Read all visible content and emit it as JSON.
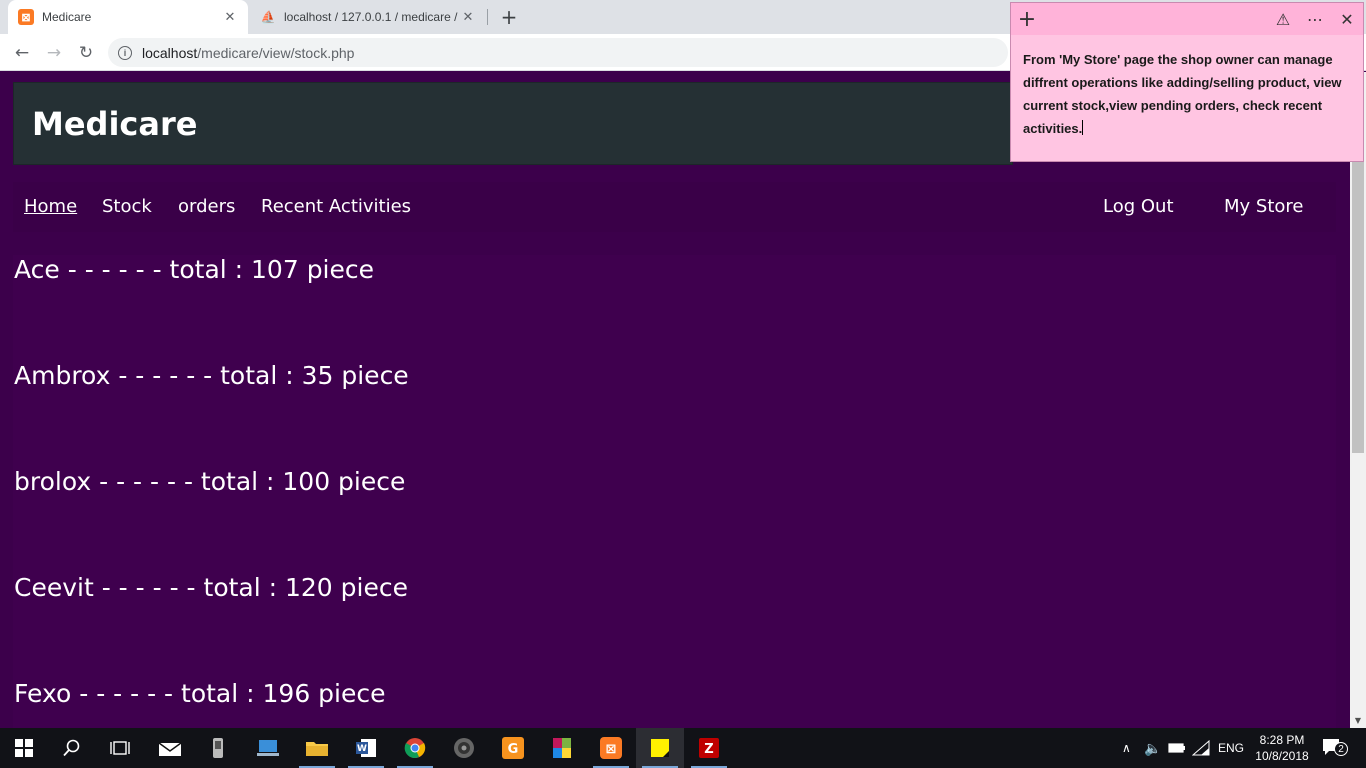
{
  "browser": {
    "tabs": [
      {
        "title": "Medicare",
        "icon": "xampp-icon"
      },
      {
        "title": "localhost / 127.0.0.1 / medicare /",
        "icon": "phpmyadmin-icon"
      }
    ],
    "new_tab_label": "+",
    "address": {
      "host": "localhost",
      "path": "/medicare/view/stock.php"
    }
  },
  "site": {
    "title": "Medicare",
    "nav_left": [
      "Home",
      "Stock",
      "orders",
      "Recent Activities"
    ],
    "nav_right": [
      "Log Out",
      "My Store"
    ],
    "stock": [
      "Ace - - - - - - total : 107 piece",
      "Ambrox - - - - - - total : 35 piece",
      "brolox - - - - - - total : 100 piece",
      "Ceevit - - - - - - total : 120 piece",
      "Fexo - - - - - - total : 196 piece"
    ]
  },
  "sticky_note": {
    "text": "From 'My Store' page the shop owner can manage diffrent operations like adding/selling product, view current stock,view pending orders, check recent activities."
  },
  "taskbar": {
    "language": "ENG",
    "time": "8:28 PM",
    "date": "10/8/2018",
    "notifications": "2"
  },
  "colors": {
    "page_bg": "#3c004b",
    "header_bg": "#253034",
    "sticky_bg": "#ffc5e2"
  }
}
